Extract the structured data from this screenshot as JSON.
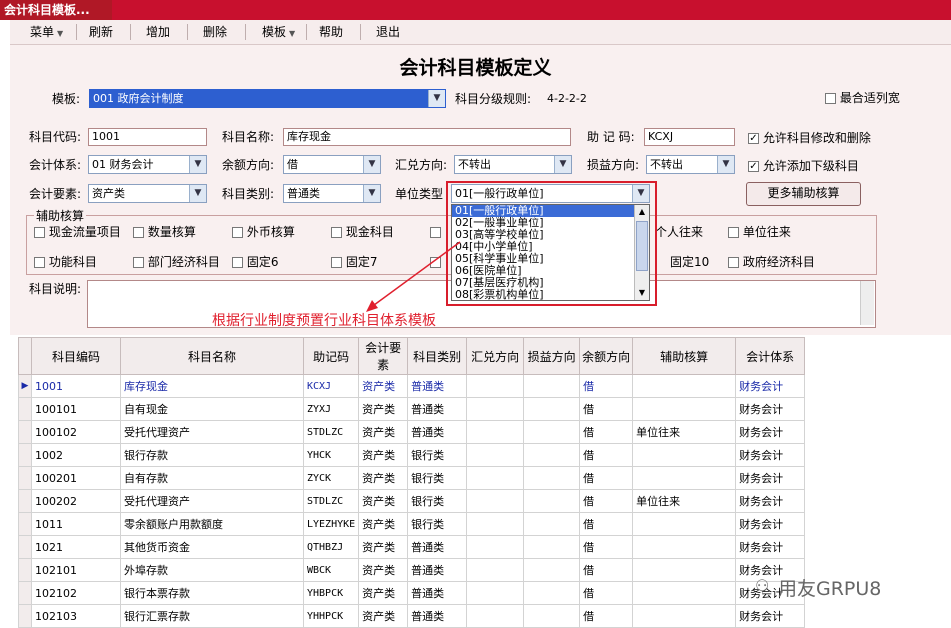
{
  "window": {
    "tab_title": "会计科目模板..."
  },
  "menu": [
    {
      "label": "菜单",
      "arrow": true
    },
    {
      "label": "刷新",
      "arrow": false
    },
    {
      "label": "增加",
      "arrow": false
    },
    {
      "label": "删除",
      "arrow": false
    },
    {
      "label": "模板",
      "arrow": true
    },
    {
      "label": "帮助",
      "arrow": false
    },
    {
      "label": "退出",
      "arrow": false
    }
  ],
  "heading": "会计科目模板定义",
  "template": {
    "label": "模板:",
    "value": "001 政府会计制度",
    "rule_label": "科目分级规则:",
    "rule_value": "4-2-2-2",
    "fit_label": "最合适列宽"
  },
  "form": {
    "code_label": "科目代码:",
    "code": "1001",
    "name_label": "科目名称:",
    "name": "库存现金",
    "mnemonic_label": "助 记 码:",
    "mnemonic": "KCXJ",
    "allow_edit_label": "允许科目修改和删除",
    "system_label": "会计体系:",
    "system": "01 财务会计",
    "balance_label": "余额方向:",
    "balance": "借",
    "exchange_label": "汇兑方向:",
    "exchange": "不转出",
    "profit_label": "损益方向:",
    "profit": "不转出",
    "allow_add_label": "允许添加下级科目",
    "element_label": "会计要素:",
    "element": "资产类",
    "category_label": "科目类别:",
    "category": "普通类",
    "unit_label": "单位类型",
    "unit": "01[一般行政单位]",
    "more_button": "更多辅助核算",
    "aux_title": "辅助核算",
    "aux_row1": [
      "现金流量项目",
      "数量核算",
      "外币核算",
      "现金科目",
      "",
      "",
      "个人往来",
      "单位往来"
    ],
    "aux_row2": [
      "功能科目",
      "部门经济科目",
      "固定6",
      "固定7",
      "",
      "",
      "固定10",
      "政府经济科目"
    ],
    "desc_label": "科目说明:"
  },
  "dropdown": {
    "items": [
      "01[一般行政单位]",
      "02[一般事业单位]",
      "03[高等学校单位]",
      "04[中小学单位]",
      "05[科学事业单位]",
      "06[医院单位]",
      "07[基层医疗机构]",
      "08[彩票机构单位]"
    ],
    "selected": 0
  },
  "annotation": "根据行业制度预置行业科目体系模板",
  "grid": {
    "headers": [
      "科目编码",
      "科目名称",
      "助记码",
      "会计要素",
      "科目类别",
      "汇兑方向",
      "损益方向",
      "余额方向",
      "辅助核算",
      "会计体系"
    ],
    "rows": [
      [
        "1001",
        "库存现金",
        "KCXJ",
        "资产类",
        "普通类",
        "",
        "",
        "借",
        "",
        "财务会计"
      ],
      [
        "100101",
        "自有现金",
        "ZYXJ",
        "资产类",
        "普通类",
        "",
        "",
        "借",
        "",
        "财务会计"
      ],
      [
        "100102",
        "受托代理资产",
        "STDLZC",
        "资产类",
        "普通类",
        "",
        "",
        "借",
        "单位往来",
        "财务会计"
      ],
      [
        "1002",
        "银行存款",
        "YHCK",
        "资产类",
        "银行类",
        "",
        "",
        "借",
        "",
        "财务会计"
      ],
      [
        "100201",
        "自有存款",
        "ZYCK",
        "资产类",
        "银行类",
        "",
        "",
        "借",
        "",
        "财务会计"
      ],
      [
        "100202",
        "受托代理资产",
        "STDLZC",
        "资产类",
        "银行类",
        "",
        "",
        "借",
        "单位往来",
        "财务会计"
      ],
      [
        "1011",
        "零余额账户用款额度",
        "LYEZHYKE",
        "资产类",
        "银行类",
        "",
        "",
        "借",
        "",
        "财务会计"
      ],
      [
        "1021",
        "其他货币资金",
        "QTHBZJ",
        "资产类",
        "普通类",
        "",
        "",
        "借",
        "",
        "财务会计"
      ],
      [
        "102101",
        "外埠存款",
        "WBCK",
        "资产类",
        "普通类",
        "",
        "",
        "借",
        "",
        "财务会计"
      ],
      [
        "102102",
        "银行本票存款",
        "YHBPCK",
        "资产类",
        "普通类",
        "",
        "",
        "借",
        "",
        "财务会计"
      ],
      [
        "102103",
        "银行汇票存款",
        "YHHPCK",
        "资产类",
        "普通类",
        "",
        "",
        "借",
        "",
        "财务会计"
      ]
    ],
    "selected_row": 0
  },
  "watermark": "用友GRPU8"
}
